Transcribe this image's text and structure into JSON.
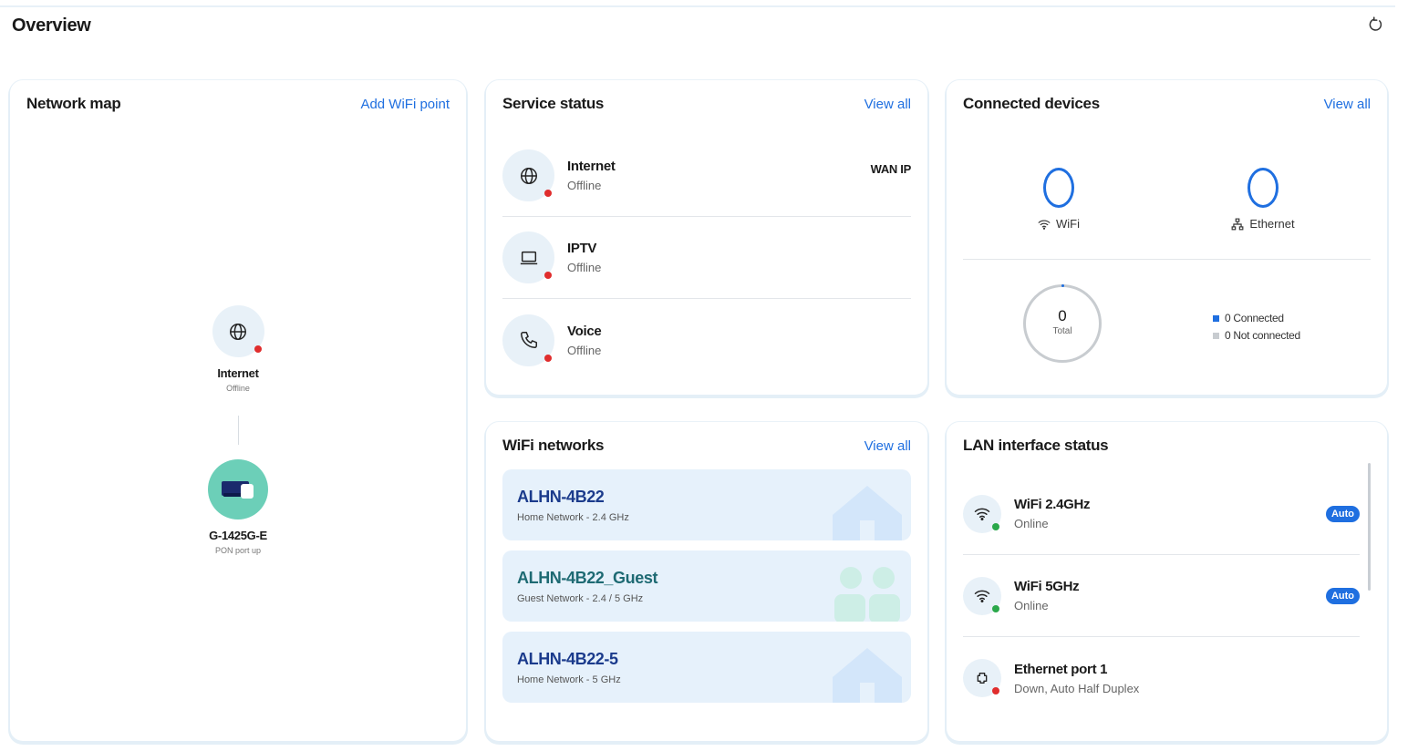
{
  "page": {
    "title": "Overview"
  },
  "network_map": {
    "title": "Network map",
    "action": "Add WiFi point",
    "internet": {
      "label": "Internet",
      "status": "Offline"
    },
    "gateway": {
      "label": "G-1425G-E",
      "status": "PON port up"
    }
  },
  "service_status": {
    "title": "Service status",
    "action": "View all",
    "items": [
      {
        "name": "Internet",
        "status": "Offline",
        "extra": "WAN IP",
        "icon": "globe-icon"
      },
      {
        "name": "IPTV",
        "status": "Offline",
        "icon": "laptop-icon"
      },
      {
        "name": "Voice",
        "status": "Offline",
        "icon": "phone-icon"
      }
    ]
  },
  "connected_devices": {
    "title": "Connected devices",
    "action": "View all",
    "wifi": {
      "count": "0",
      "label": "WiFi"
    },
    "ethernet": {
      "count": "0",
      "label": "Ethernet"
    },
    "total": {
      "count": "0",
      "label": "Total"
    },
    "legend": {
      "connected": "0 Connected",
      "not_connected": "0 Not connected"
    }
  },
  "wifi_networks": {
    "title": "WiFi networks",
    "action": "View all",
    "items": [
      {
        "ssid": "ALHN-4B22",
        "desc": "Home Network - 2.4 GHz"
      },
      {
        "ssid": "ALHN-4B22_Guest",
        "desc": "Guest Network - 2.4 / 5 GHz"
      },
      {
        "ssid": "ALHN-4B22-5",
        "desc": "Home Network - 5 GHz"
      }
    ]
  },
  "lan_interface": {
    "title": "LAN interface status",
    "items": [
      {
        "name": "WiFi 2.4GHz",
        "status": "Online",
        "badge": "Auto"
      },
      {
        "name": "WiFi 5GHz",
        "status": "Online",
        "badge": "Auto"
      },
      {
        "name": "Ethernet port 1",
        "status": "Down, Auto Half Duplex"
      }
    ]
  },
  "colors": {
    "accent": "#1f6fe0",
    "offline": "#e02d2d",
    "online": "#2aa84a",
    "icon_bg": "#e8f1f8",
    "wifi_card_bg": "#e6f1fb",
    "gateway_bg": "#6ccfb8",
    "not_connected": "#c8ccd0"
  }
}
